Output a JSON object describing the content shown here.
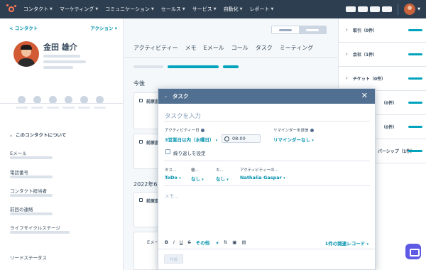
{
  "topnav": {
    "items": [
      "コンタクト",
      "マーケティング",
      "コミュニケーション",
      "セールス",
      "サービス",
      "自動化",
      "レポート"
    ],
    "chevron": "chevron-down-icon"
  },
  "left": {
    "back_label": "< コンタクト",
    "actions_label": "アクション ▾",
    "contact_name": "金田 雄介",
    "about_label": "このコンタクトについて",
    "properties": [
      "Eメール",
      "電話番号",
      "コンタクト担当者",
      "前回の連絡",
      "ライフサイクルステージ",
      "リードステータス"
    ]
  },
  "middle": {
    "tabs": [
      "アクティビティー",
      "メモ",
      "Eメール",
      "コール",
      "タスク",
      "ミーティング"
    ],
    "future_label": "今後",
    "card_title": "前原直",
    "date_heading": "2022年6月",
    "email_label": "Eメール"
  },
  "right": {
    "associations": [
      "取引（0件）",
      "会社（1件）",
      "チケット（0件）",
      "（0件）",
      "（0件）",
      "パーシップ（1件）"
    ]
  },
  "modal": {
    "title": "タスク",
    "close_icon": "close-icon",
    "task_placeholder": "タスクを入力",
    "activity_date_label": "アクティビティー日",
    "activity_date_value": "3営業日以内（水曜日）",
    "time_value": "08:00",
    "reminder_label": "リマインダーを送信",
    "reminder_value": "リマインダーなし",
    "repeat_label": "繰り返しを設定",
    "fields": [
      {
        "label": "タス...",
        "value": "ToDo"
      },
      {
        "label": "優...",
        "value": "なし"
      },
      {
        "label": "キ...",
        "value": "なし"
      },
      {
        "label": "アクティビティーの...",
        "value": "Nathalia Gaspar"
      }
    ],
    "notes_placeholder": "メモ...",
    "toolbar": {
      "bold": "B",
      "italic": "I",
      "underline": "U",
      "more": "その他"
    },
    "records_link": "1件の関連レコード",
    "create_button": "作成"
  },
  "colors": {
    "nav_bg": "#2d3e50",
    "accent": "#0091ae",
    "teal_bar": "#00a4bd",
    "modal_header": "#516f90",
    "brand": "#ff7a59",
    "chat_button": "#5e5ae6"
  }
}
